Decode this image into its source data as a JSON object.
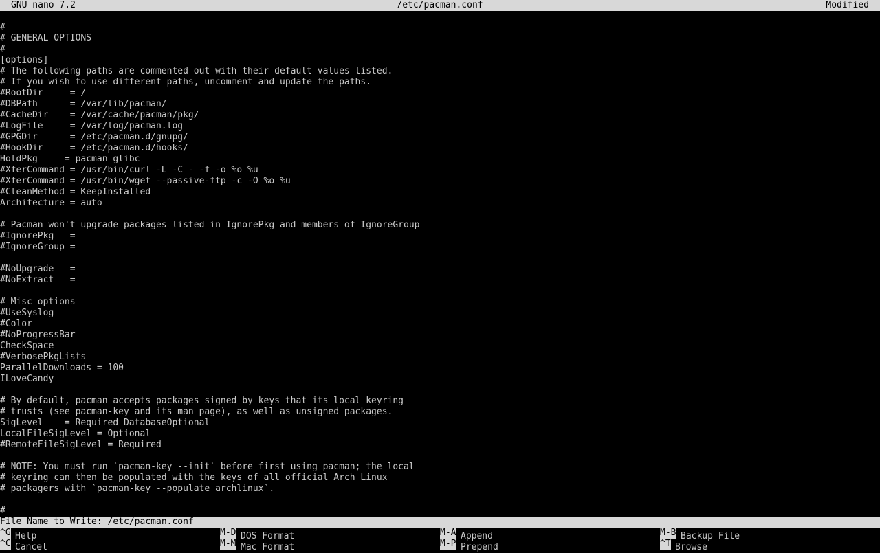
{
  "titlebar": {
    "app": "GNU nano 7.2",
    "file": "/etc/pacman.conf",
    "status": "Modified"
  },
  "editor": {
    "lines": [
      "",
      "#",
      "# GENERAL OPTIONS",
      "#",
      "[options]",
      "# The following paths are commented out with their default values listed.",
      "# If you wish to use different paths, uncomment and update the paths.",
      "#RootDir     = /",
      "#DBPath      = /var/lib/pacman/",
      "#CacheDir    = /var/cache/pacman/pkg/",
      "#LogFile     = /var/log/pacman.log",
      "#GPGDir      = /etc/pacman.d/gnupg/",
      "#HookDir     = /etc/pacman.d/hooks/",
      "HoldPkg     = pacman glibc",
      "#XferCommand = /usr/bin/curl -L -C - -f -o %o %u",
      "#XferCommand = /usr/bin/wget --passive-ftp -c -O %o %u",
      "#CleanMethod = KeepInstalled",
      "Architecture = auto",
      "",
      "# Pacman won't upgrade packages listed in IgnorePkg and members of IgnoreGroup",
      "#IgnorePkg   =",
      "#IgnoreGroup =",
      "",
      "#NoUpgrade   =",
      "#NoExtract   =",
      "",
      "# Misc options",
      "#UseSyslog",
      "#Color",
      "#NoProgressBar",
      "CheckSpace",
      "#VerbosePkgLists",
      "ParallelDownloads = 100",
      "ILoveCandy",
      "",
      "# By default, pacman accepts packages signed by keys that its local keyring",
      "# trusts (see pacman-key and its man page), as well as unsigned packages.",
      "SigLevel    = Required DatabaseOptional",
      "LocalFileSigLevel = Optional",
      "#RemoteFileSigLevel = Required",
      "",
      "# NOTE: You must run `pacman-key --init` before first using pacman; the local",
      "# keyring can then be populated with the keys of all official Arch Linux",
      "# packagers with `pacman-key --populate archlinux`.",
      "",
      "#"
    ]
  },
  "prompt": {
    "label": "File Name to Write: ",
    "value": "/etc/pacman.conf"
  },
  "shortcuts": [
    {
      "key": "^G",
      "label": "Help"
    },
    {
      "key": "^C",
      "label": "Cancel"
    },
    {
      "key": "M-D",
      "label": "DOS Format"
    },
    {
      "key": "M-M",
      "label": "Mac Format"
    },
    {
      "key": "M-A",
      "label": "Append"
    },
    {
      "key": "M-P",
      "label": "Prepend"
    },
    {
      "key": "M-B",
      "label": "Backup File"
    },
    {
      "key": "^T",
      "label": "Browse"
    }
  ]
}
